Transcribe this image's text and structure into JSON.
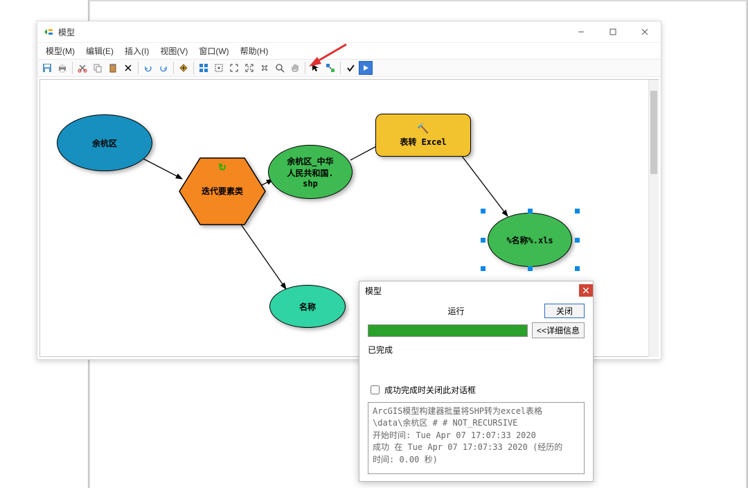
{
  "window": {
    "title": "模型",
    "menu": {
      "model": "模型(M)",
      "edit": "编辑(E)",
      "insert": "插入(I)",
      "view": "视图(V)",
      "window": "窗口(W)",
      "help": "帮助(H)"
    }
  },
  "nodes": {
    "input": "余杭区",
    "iterator": "迭代要素类",
    "feature": "余杭区_中华\n人民共和国.\nshp",
    "tool": "表转 Excel",
    "output": "%名称%.xls",
    "name": "名称"
  },
  "dialog": {
    "title": "模型",
    "run_label": "运行",
    "close_btn": "关闭",
    "details_btn": "<<详细信息",
    "status": "已完成",
    "checkbox": "成功完成时关闭此对话框",
    "log": "ArcGIS模型构建器批量将SHP转为excel表格\n\\data\\余杭区 # # NOT_RECURSIVE\n开始时间: Tue Apr 07 17:07:33 2020\n成功 在 Tue Apr 07 17:07:33 2020 (经历的\n时间: 0.00 秒)"
  }
}
